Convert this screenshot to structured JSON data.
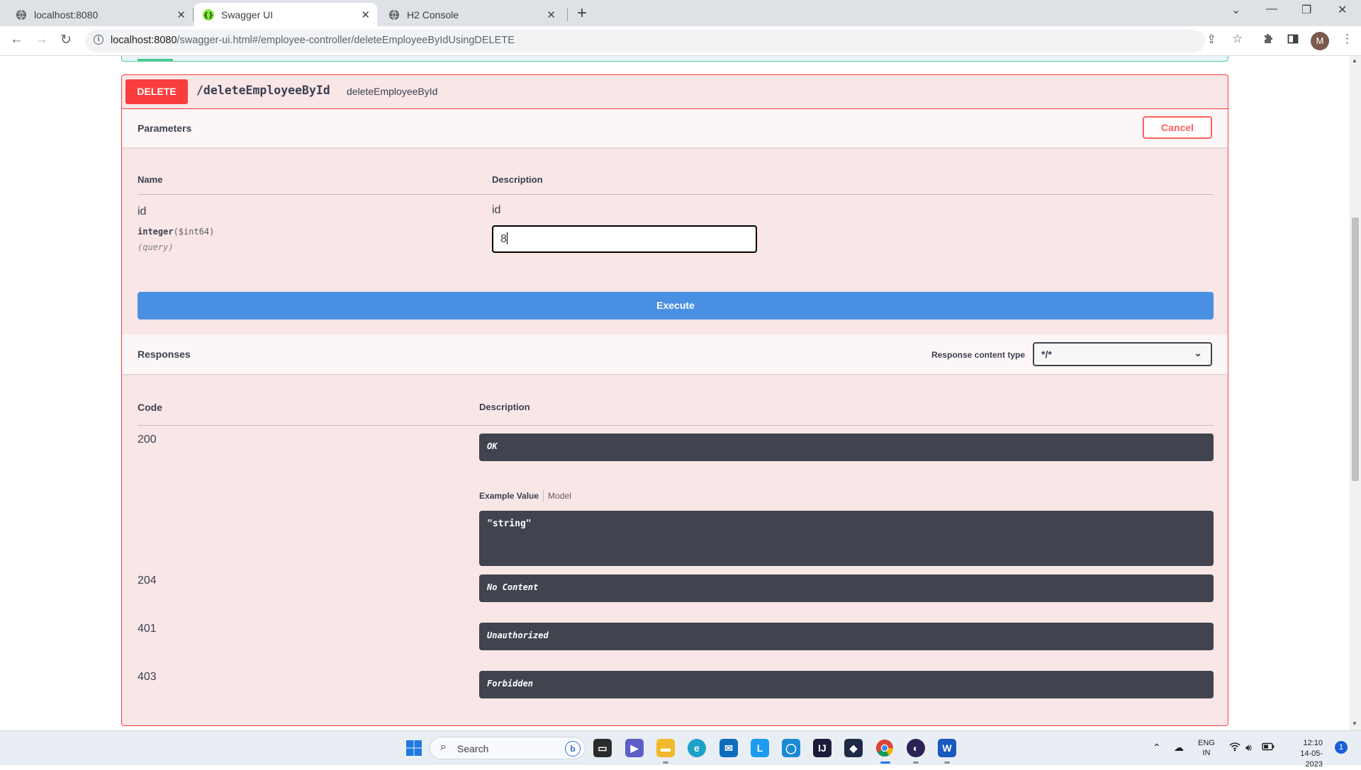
{
  "browser": {
    "tabs": [
      {
        "label": "localhost:8080",
        "active": false,
        "icon": "globe-icon"
      },
      {
        "label": "Swagger UI",
        "active": true,
        "icon": "swagger-icon"
      },
      {
        "label": "H2 Console",
        "active": false,
        "icon": "globe-icon"
      }
    ],
    "url_host": "localhost:8080",
    "url_path": "/swagger-ui.html#/employee-controller/deleteEmployeeByIdUsingDELETE",
    "profile_initial": "M"
  },
  "operation": {
    "method": "DELETE",
    "path": "/deleteEmployeeById",
    "description": "deleteEmployeeById",
    "method_color": "#f93e3e"
  },
  "parameters": {
    "title": "Parameters",
    "cancel_label": "Cancel",
    "col_name": "Name",
    "col_description": "Description",
    "items": [
      {
        "name": "id",
        "type": "integer",
        "format": "($int64)",
        "in": "(query)",
        "description": "id",
        "value": "8"
      }
    ]
  },
  "execute_label": "Execute",
  "responses": {
    "title": "Responses",
    "content_type_label": "Response content type",
    "content_type_value": "*/*",
    "col_code": "Code",
    "col_description": "Description",
    "example_tab": "Example Value",
    "model_tab": "Model",
    "example_value": "\"string\"",
    "items": [
      {
        "code": "200",
        "description": "OK"
      },
      {
        "code": "204",
        "description": "No Content"
      },
      {
        "code": "401",
        "description": "Unauthorized"
      },
      {
        "code": "403",
        "description": "Forbidden"
      }
    ]
  },
  "taskbar": {
    "search_placeholder": "Search",
    "lang_top": "ENG",
    "lang_bottom": "IN",
    "time": "12:10",
    "date": "14-05-2023",
    "notification_count": "1"
  }
}
